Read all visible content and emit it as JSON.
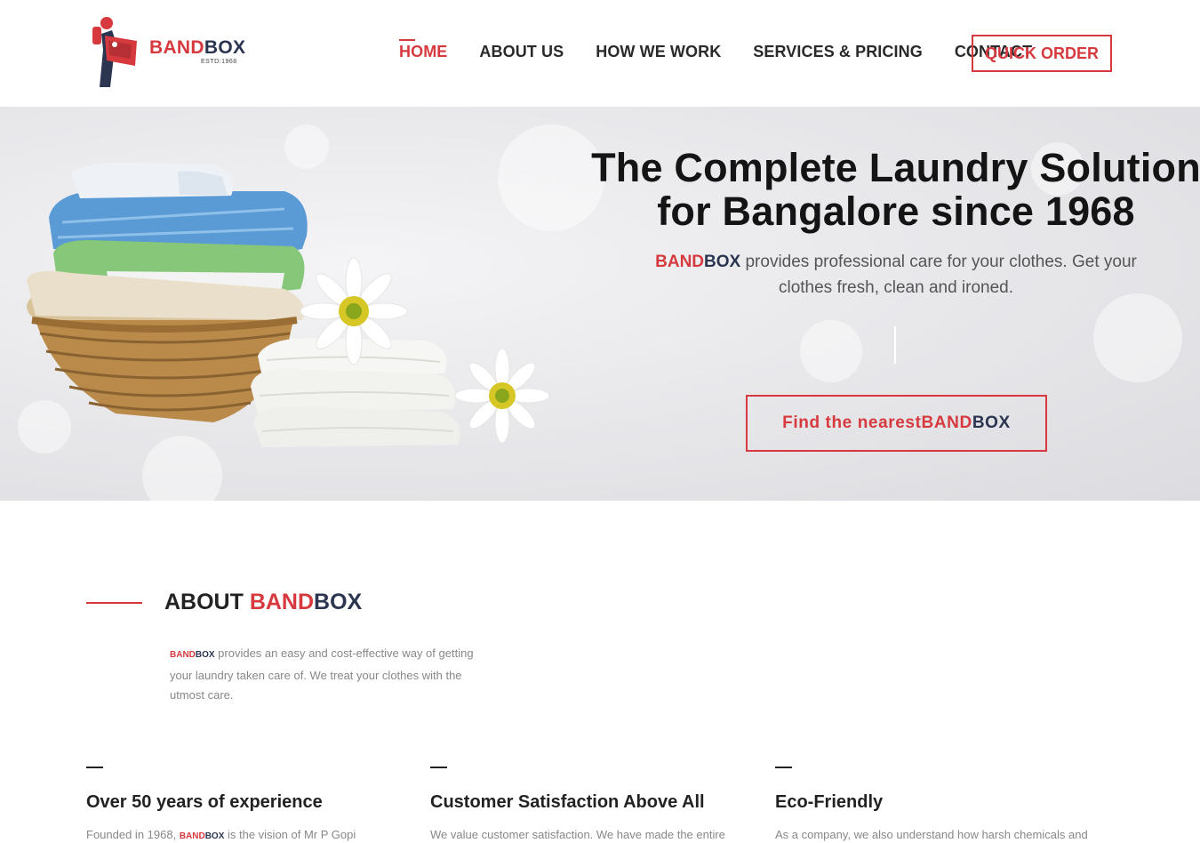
{
  "brand": {
    "band": "BAND",
    "box": "BOX",
    "established": "ESTD:1968",
    "colors": {
      "red": "#d63a3f",
      "navy": "#2b3550"
    }
  },
  "nav": {
    "items": [
      {
        "label": "HOME",
        "active": true
      },
      {
        "label": "ABOUT US",
        "active": false
      },
      {
        "label": "HOW WE WORK",
        "active": false
      },
      {
        "label": "SERVICES & PRICING",
        "active": false
      },
      {
        "label": "CONTACT",
        "active": false
      }
    ],
    "quick_order": "QUICK ORDER"
  },
  "hero": {
    "title_line1": "The Complete Laundry Solution",
    "title_line2": "for Bangalore since 1968",
    "subtitle_brand_band": "BAND",
    "subtitle_brand_box": "BOX",
    "subtitle_rest": " provides professional care for your clothes. Get your clothes fresh, clean and ironed.",
    "cta_text": "Find the nearest ",
    "cta_band": "BAND",
    "cta_box": "BOX"
  },
  "about": {
    "heading_prefix": "ABOUT ",
    "heading_band": "BAND",
    "heading_box": "BOX",
    "brand_band": "BAND",
    "brand_box": "BOX",
    "text": " provides an easy and cost-effective way of getting your laundry taken care of. We treat your clothes with the utmost care."
  },
  "features": [
    {
      "title": "Over 50 years of experience",
      "text_before": "Founded in 1968, ",
      "band": "BAND",
      "box": "BOX",
      "text_after": " is the vision of Mr P Gopi"
    },
    {
      "title": "Customer Satisfaction Above All",
      "text": "We value customer satisfaction. We have made the entire"
    },
    {
      "title": "Eco-Friendly",
      "text": "As a company, we also understand how harsh chemicals and"
    }
  ]
}
